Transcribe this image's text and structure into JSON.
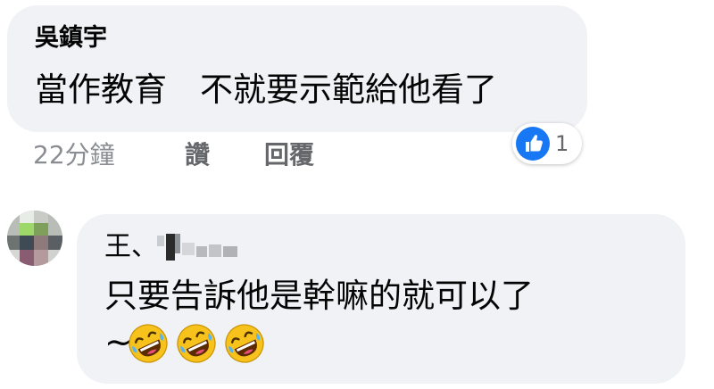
{
  "comment1": {
    "author": "吳鎮宇",
    "text": "當作教育　不就要示範給他看了",
    "time": "22分鐘",
    "like_label": "讚",
    "reply_label": "回覆",
    "reaction": {
      "icon": "thumbs-up-icon",
      "count": "1",
      "color": "#1877f2"
    }
  },
  "comment2": {
    "author": "王、",
    "text": "只要告訴他是幹嘛的就可以了",
    "suffix": "~",
    "emojis": [
      "rolling-on-floor-laughing-icon",
      "rolling-on-floor-laughing-icon",
      "rolling-on-floor-laughing-icon"
    ]
  },
  "colors": {
    "bubble": "#f0f2f5",
    "text": "#050505",
    "secondary": "#65676b",
    "like_blue": "#1877f2"
  }
}
